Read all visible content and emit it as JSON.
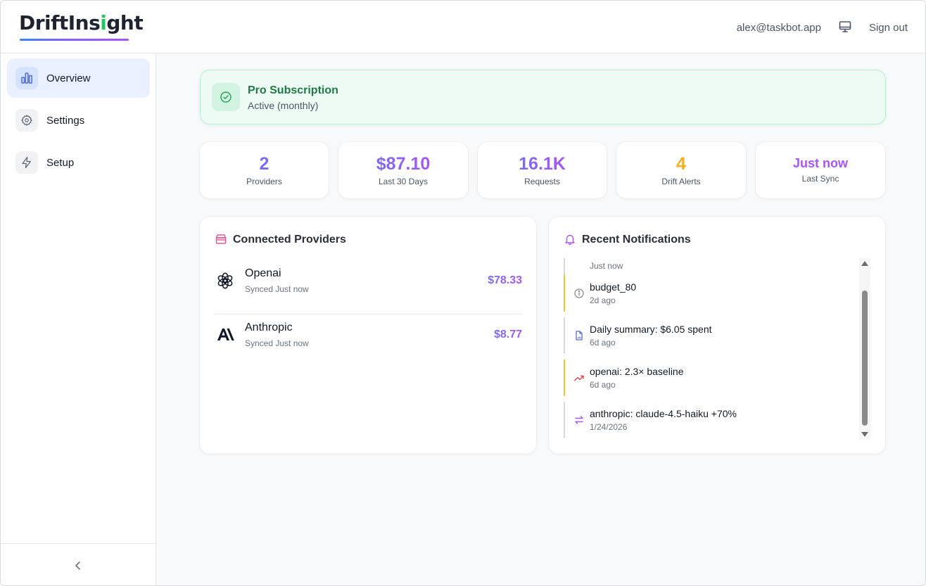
{
  "header": {
    "logo_part1": "DriftIns",
    "logo_accent": "i",
    "logo_part2": "ght",
    "user_email": "alex@taskbot.app",
    "monitor_icon": "monitor-icon",
    "signout_label": "Sign out"
  },
  "sidebar": {
    "items": [
      {
        "label": "Overview",
        "icon": "bar-chart-icon",
        "active": true
      },
      {
        "label": "Settings",
        "icon": "gear-icon",
        "active": false
      },
      {
        "label": "Setup",
        "icon": "bolt-icon",
        "active": false
      }
    ],
    "collapse_icon": "chevron-left-icon"
  },
  "subscription": {
    "title": "Pro Subscription",
    "status": "Active (monthly)",
    "icon": "check-circle-icon",
    "accent": "#1f7a45"
  },
  "stats": [
    {
      "value": "2",
      "label": "Providers",
      "color": "#7c6cf2"
    },
    {
      "value": "$87.10",
      "label": "Last 30 Days",
      "color": "#8b5cf6"
    },
    {
      "value": "16.1K",
      "label": "Requests",
      "color": "#8b5cf6"
    },
    {
      "value": "4",
      "label": "Drift Alerts",
      "color": "#f5b014"
    },
    {
      "value": "Just now",
      "label": "Last Sync",
      "color": "#a855f7"
    }
  ],
  "providers_panel": {
    "title": "Connected Providers",
    "icon": "archive-icon",
    "items": [
      {
        "name": "Openai",
        "sync": "Synced Just now",
        "cost": "$78.33",
        "icon": "openai-logo-icon"
      },
      {
        "name": "Anthropic",
        "sync": "Synced Just now",
        "cost": "$8.77",
        "icon": "anthropic-logo-icon"
      }
    ]
  },
  "notifications_panel": {
    "title": "Recent Notifications",
    "icon": "bell-icon",
    "items": [
      {
        "title": "",
        "time": "Just now",
        "icon": "",
        "severity": "normal"
      },
      {
        "title": "budget_80",
        "time": "2d ago",
        "icon": "info-icon",
        "severity": "warn"
      },
      {
        "title": "Daily summary: $6.05 spent",
        "time": "6d ago",
        "icon": "document-icon",
        "severity": "normal"
      },
      {
        "title": "openai: 2.3× baseline",
        "time": "6d ago",
        "icon": "trending-up-icon",
        "severity": "warn"
      },
      {
        "title": "anthropic: claude-4.5-haiku +70%",
        "time": "1/24/2026",
        "icon": "swap-arrows-icon",
        "severity": "normal"
      }
    ]
  }
}
